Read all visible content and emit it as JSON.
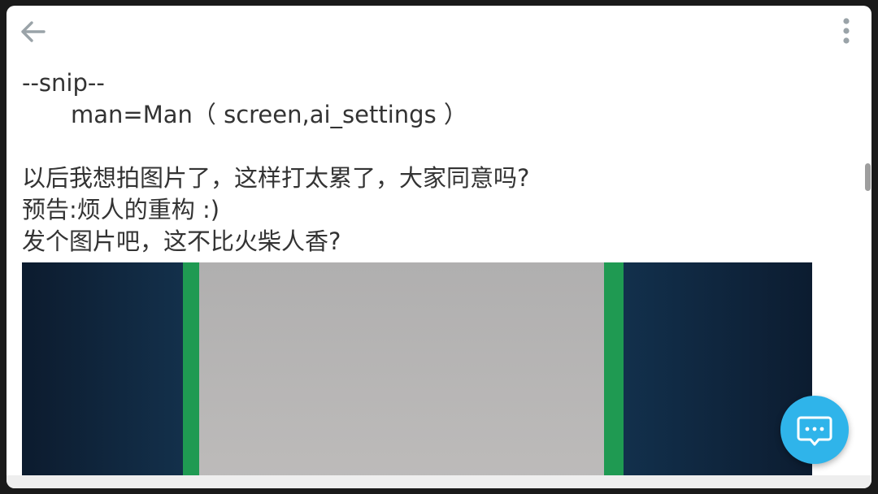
{
  "toolbar": {
    "back_icon": "arrow-left-icon",
    "more_icon": "more-vertical-icon"
  },
  "post": {
    "lines": [
      "--snip--",
      "man=Man（ screen,ai_settings ）",
      "",
      "以后我想拍图片了，这样打太累了，大家同意吗?",
      "预告:烦人的重构 :)",
      "发个图片吧，这不比火柴人香?"
    ]
  },
  "fab": {
    "icon": "comment-icon"
  },
  "colors": {
    "text": "#333333",
    "icon_gray": "#9aa3a8",
    "fab": "#2fb4ea",
    "photo_wall": "#0f2236",
    "photo_board": "#b9b7b6",
    "photo_tape": "#1f9a52"
  }
}
